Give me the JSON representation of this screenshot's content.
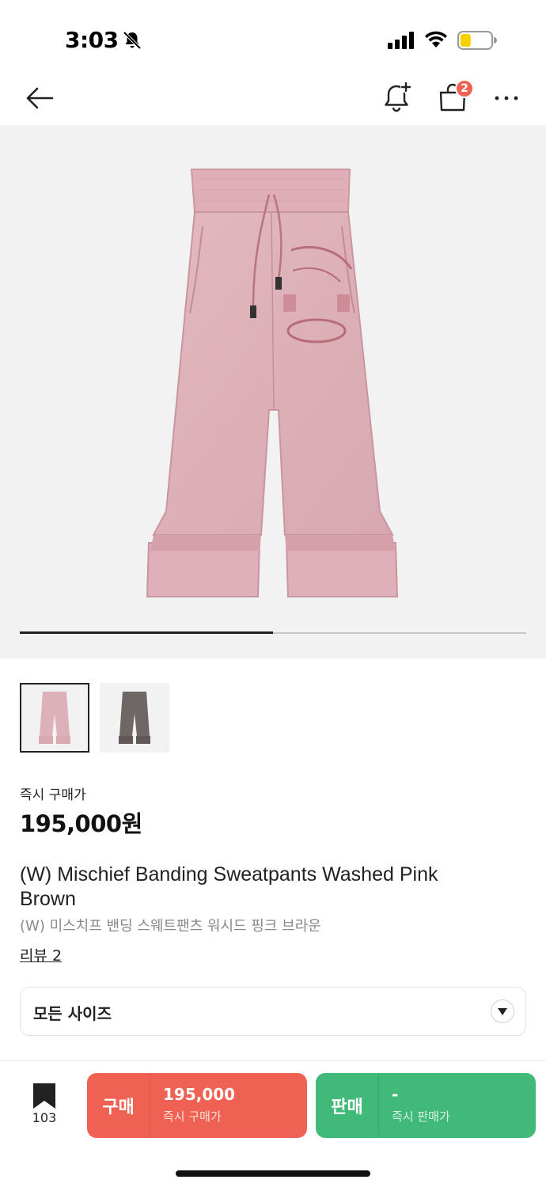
{
  "status_bar": {
    "time": "3:03",
    "icons": [
      "bell-slash-icon",
      "signal-icon",
      "wifi-icon",
      "battery-icon"
    ],
    "battery_level": 0.35,
    "battery_color": "#f5d100"
  },
  "nav": {
    "icons": [
      "back-arrow-icon",
      "bell-plus-icon",
      "shopping-bag-icon",
      "more-dots-icon"
    ],
    "cart_count": "2"
  },
  "gallery": {
    "progress": 0.5,
    "thumbnails": [
      {
        "color": "pink",
        "selected": true
      },
      {
        "color": "brown",
        "selected": false
      }
    ]
  },
  "product": {
    "price_label": "즉시 구매가",
    "price": "195,000원",
    "title_en": "(W) Mischief Banding Sweatpants Washed Pink Brown",
    "title_ko": "(W) 미스치프 밴딩 스웨트팬츠 워시드 핑크 브라운",
    "review_link": "리뷰 2"
  },
  "size_select": {
    "value": "모든 사이즈"
  },
  "bottom_bar": {
    "wish_count": "103",
    "buy": {
      "label": "구매",
      "price": "195,000",
      "sub": "즉시 구매가",
      "color": "#ef6253"
    },
    "sell": {
      "label": "판매",
      "price": "-",
      "sub": "즉시 판매가",
      "color": "#41b979"
    }
  }
}
